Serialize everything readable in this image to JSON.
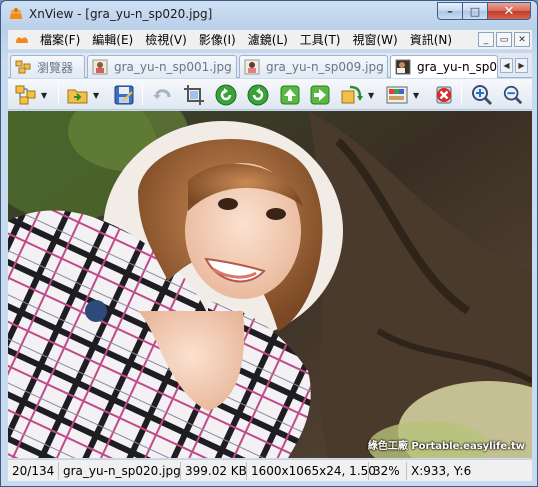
{
  "window": {
    "title": "XnView - [gra_yu-n_sp020.jpg]",
    "caption_buttons": {
      "minimize": "–",
      "maximize": "□",
      "close": "✕"
    }
  },
  "menubar": {
    "items": [
      "檔案(F)",
      "編輯(E)",
      "檢視(V)",
      "影像(I)",
      "濾鏡(L)",
      "工具(T)",
      "視窗(W)",
      "資訊(N)"
    ],
    "mdi_buttons": {
      "minimize": "_",
      "restore": "▭",
      "close": "✕"
    }
  },
  "tabs": [
    {
      "label": "瀏覽器",
      "icon": "browser-icon",
      "active": false
    },
    {
      "label": "gra_yu-n_sp001.jpg",
      "icon": "photo-thumb-icon",
      "active": false
    },
    {
      "label": "gra_yu-n_sp009.jpg",
      "icon": "photo-thumb-icon",
      "active": false
    },
    {
      "label": "gra_yu-n_sp0",
      "icon": "photo-thumb-icon",
      "active": true
    }
  ],
  "tab_scroll": {
    "left": "◀",
    "right": "▶"
  },
  "toolbar": {
    "buttons": [
      "browser-icon",
      "open-folder-icon",
      "save-icon",
      "undo-icon",
      "crop-icon",
      "rotate-left-icon",
      "rotate-right-icon",
      "previous-icon",
      "next-icon",
      "convert-icon",
      "adjust-icon",
      "delete-icon",
      "zoom-in-icon",
      "zoom-out-icon"
    ],
    "dropdown_arrow": "▼"
  },
  "viewer": {
    "watermark": "綠色工廠 Portable.easylife.tw"
  },
  "statusbar": {
    "index": "20/134",
    "filename": "gra_yu-n_sp020.jpg",
    "filesize": "399.02 KB",
    "dimensions": "1600x1065x24, 1.50",
    "zoom": "32%",
    "coords": "X:933, Y:6"
  },
  "colors": {
    "titlebar": "#c4d7ee",
    "close_button": "#c23a27",
    "menubar": "#f0f0f0",
    "statusbar": "#f0f0f0"
  }
}
